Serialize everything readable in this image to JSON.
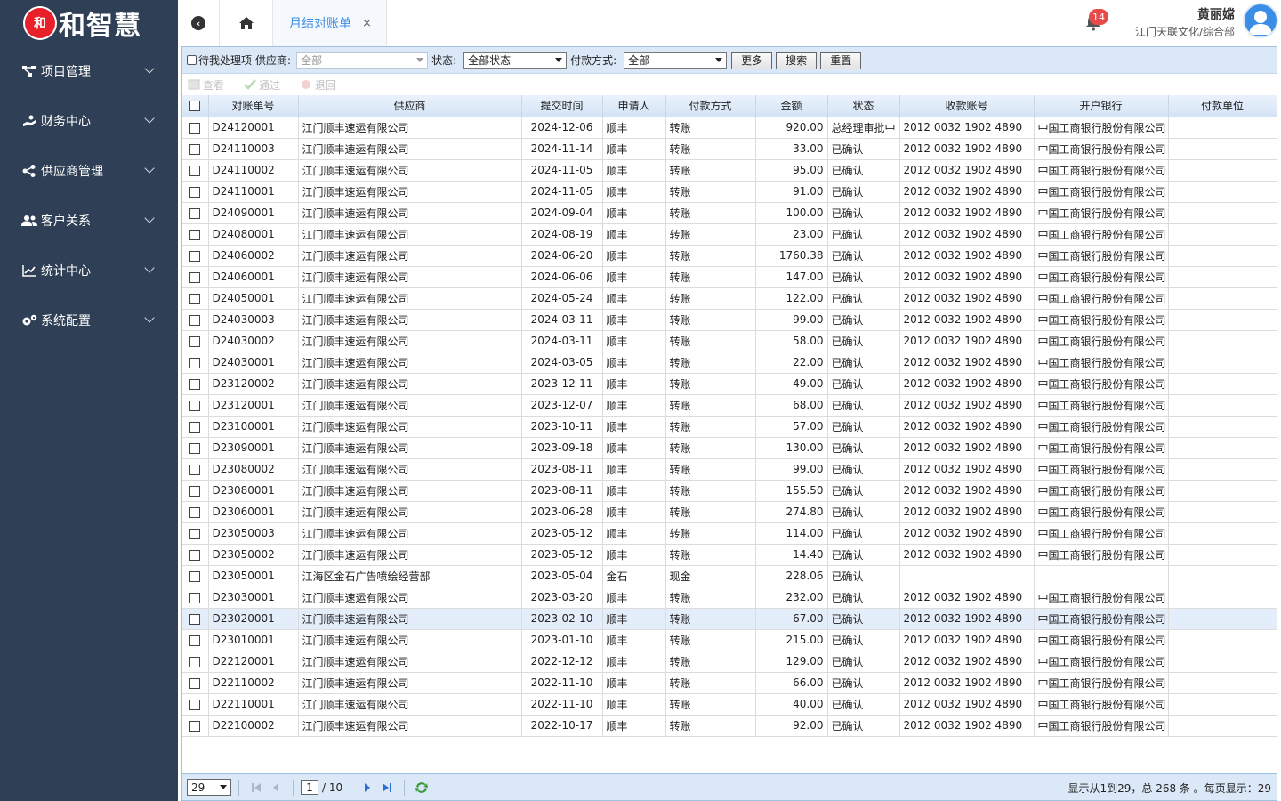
{
  "sidebar": {
    "logo_badge": "和",
    "logo_text": "和智慧",
    "items": [
      {
        "label": "项目管理",
        "icon": "project-tree-icon"
      },
      {
        "label": "财务中心",
        "icon": "finance-icon"
      },
      {
        "label": "供应商管理",
        "icon": "share-icon"
      },
      {
        "label": "客户关系",
        "icon": "users-icon"
      },
      {
        "label": "统计中心",
        "icon": "chart-icon"
      },
      {
        "label": "系统配置",
        "icon": "gears-icon"
      }
    ]
  },
  "topbar": {
    "tab_label": "月结对账单",
    "tab_close": "×",
    "notification_count": "14",
    "user_name": "黄丽嫦",
    "user_org": "江门天联文化/综合部"
  },
  "filters": {
    "pending_label": "待我处理项",
    "supplier_label": "供应商:",
    "supplier_value": "全部",
    "status_label": "状态:",
    "status_value": "全部状态",
    "pay_label": "付款方式:",
    "pay_value": "全部",
    "more": "更多",
    "search": "搜索",
    "reset": "重置"
  },
  "toolbar": {
    "view": "查看",
    "approve": "通过",
    "return": "退回"
  },
  "columns": [
    "对账单号",
    "供应商",
    "提交时间",
    "申请人",
    "付款方式",
    "金额",
    "状态",
    "收款账号",
    "开户银行",
    "付款单位"
  ],
  "rows": [
    [
      "D24120001",
      "江门顺丰速运有限公司",
      "2024-12-06",
      "顺丰",
      "转账",
      "920.00",
      "总经理审批中",
      "2012 0032 1902 4890",
      "中国工商银行股份有限公司",
      ""
    ],
    [
      "D24110003",
      "江门顺丰速运有限公司",
      "2024-11-14",
      "顺丰",
      "转账",
      "33.00",
      "已确认",
      "2012 0032 1902 4890",
      "中国工商银行股份有限公司",
      ""
    ],
    [
      "D24110002",
      "江门顺丰速运有限公司",
      "2024-11-05",
      "顺丰",
      "转账",
      "95.00",
      "已确认",
      "2012 0032 1902 4890",
      "中国工商银行股份有限公司",
      ""
    ],
    [
      "D24110001",
      "江门顺丰速运有限公司",
      "2024-11-05",
      "顺丰",
      "转账",
      "91.00",
      "已确认",
      "2012 0032 1902 4890",
      "中国工商银行股份有限公司",
      ""
    ],
    [
      "D24090001",
      "江门顺丰速运有限公司",
      "2024-09-04",
      "顺丰",
      "转账",
      "100.00",
      "已确认",
      "2012 0032 1902 4890",
      "中国工商银行股份有限公司",
      ""
    ],
    [
      "D24080001",
      "江门顺丰速运有限公司",
      "2024-08-19",
      "顺丰",
      "转账",
      "23.00",
      "已确认",
      "2012 0032 1902 4890",
      "中国工商银行股份有限公司",
      ""
    ],
    [
      "D24060002",
      "江门顺丰速运有限公司",
      "2024-06-20",
      "顺丰",
      "转账",
      "1760.38",
      "已确认",
      "2012 0032 1902 4890",
      "中国工商银行股份有限公司",
      ""
    ],
    [
      "D24060001",
      "江门顺丰速运有限公司",
      "2024-06-06",
      "顺丰",
      "转账",
      "147.00",
      "已确认",
      "2012 0032 1902 4890",
      "中国工商银行股份有限公司",
      ""
    ],
    [
      "D24050001",
      "江门顺丰速运有限公司",
      "2024-05-24",
      "顺丰",
      "转账",
      "122.00",
      "已确认",
      "2012 0032 1902 4890",
      "中国工商银行股份有限公司",
      ""
    ],
    [
      "D24030003",
      "江门顺丰速运有限公司",
      "2024-03-11",
      "顺丰",
      "转账",
      "99.00",
      "已确认",
      "2012 0032 1902 4890",
      "中国工商银行股份有限公司",
      ""
    ],
    [
      "D24030002",
      "江门顺丰速运有限公司",
      "2024-03-11",
      "顺丰",
      "转账",
      "58.00",
      "已确认",
      "2012 0032 1902 4890",
      "中国工商银行股份有限公司",
      ""
    ],
    [
      "D24030001",
      "江门顺丰速运有限公司",
      "2024-03-05",
      "顺丰",
      "转账",
      "22.00",
      "已确认",
      "2012 0032 1902 4890",
      "中国工商银行股份有限公司",
      ""
    ],
    [
      "D23120002",
      "江门顺丰速运有限公司",
      "2023-12-11",
      "顺丰",
      "转账",
      "49.00",
      "已确认",
      "2012 0032 1902 4890",
      "中国工商银行股份有限公司",
      ""
    ],
    [
      "D23120001",
      "江门顺丰速运有限公司",
      "2023-12-07",
      "顺丰",
      "转账",
      "68.00",
      "已确认",
      "2012 0032 1902 4890",
      "中国工商银行股份有限公司",
      ""
    ],
    [
      "D23100001",
      "江门顺丰速运有限公司",
      "2023-10-11",
      "顺丰",
      "转账",
      "57.00",
      "已确认",
      "2012 0032 1902 4890",
      "中国工商银行股份有限公司",
      ""
    ],
    [
      "D23090001",
      "江门顺丰速运有限公司",
      "2023-09-18",
      "顺丰",
      "转账",
      "130.00",
      "已确认",
      "2012 0032 1902 4890",
      "中国工商银行股份有限公司",
      ""
    ],
    [
      "D23080002",
      "江门顺丰速运有限公司",
      "2023-08-11",
      "顺丰",
      "转账",
      "99.00",
      "已确认",
      "2012 0032 1902 4890",
      "中国工商银行股份有限公司",
      ""
    ],
    [
      "D23080001",
      "江门顺丰速运有限公司",
      "2023-08-11",
      "顺丰",
      "转账",
      "155.50",
      "已确认",
      "2012 0032 1902 4890",
      "中国工商银行股份有限公司",
      ""
    ],
    [
      "D23060001",
      "江门顺丰速运有限公司",
      "2023-06-28",
      "顺丰",
      "转账",
      "274.80",
      "已确认",
      "2012 0032 1902 4890",
      "中国工商银行股份有限公司",
      ""
    ],
    [
      "D23050003",
      "江门顺丰速运有限公司",
      "2023-05-12",
      "顺丰",
      "转账",
      "114.00",
      "已确认",
      "2012 0032 1902 4890",
      "中国工商银行股份有限公司",
      ""
    ],
    [
      "D23050002",
      "江门顺丰速运有限公司",
      "2023-05-12",
      "顺丰",
      "转账",
      "14.40",
      "已确认",
      "2012 0032 1902 4890",
      "中国工商银行股份有限公司",
      ""
    ],
    [
      "D23050001",
      "江海区金石广告喷绘经营部",
      "2023-05-04",
      "金石",
      "现金",
      "228.06",
      "已确认",
      "",
      "",
      ""
    ],
    [
      "D23030001",
      "江门顺丰速运有限公司",
      "2023-03-20",
      "顺丰",
      "转账",
      "232.00",
      "已确认",
      "2012 0032 1902 4890",
      "中国工商银行股份有限公司",
      ""
    ],
    [
      "D23020001",
      "江门顺丰速运有限公司",
      "2023-02-10",
      "顺丰",
      "转账",
      "67.00",
      "已确认",
      "2012 0032 1902 4890",
      "中国工商银行股份有限公司",
      ""
    ],
    [
      "D23010001",
      "江门顺丰速运有限公司",
      "2023-01-10",
      "顺丰",
      "转账",
      "215.00",
      "已确认",
      "2012 0032 1902 4890",
      "中国工商银行股份有限公司",
      ""
    ],
    [
      "D22120001",
      "江门顺丰速运有限公司",
      "2022-12-12",
      "顺丰",
      "转账",
      "129.00",
      "已确认",
      "2012 0032 1902 4890",
      "中国工商银行股份有限公司",
      ""
    ],
    [
      "D22110002",
      "江门顺丰速运有限公司",
      "2022-11-10",
      "顺丰",
      "转账",
      "66.00",
      "已确认",
      "2012 0032 1902 4890",
      "中国工商银行股份有限公司",
      ""
    ],
    [
      "D22110001",
      "江门顺丰速运有限公司",
      "2022-11-10",
      "顺丰",
      "转账",
      "40.00",
      "已确认",
      "2012 0032 1902 4890",
      "中国工商银行股份有限公司",
      ""
    ],
    [
      "D22100002",
      "江门顺丰速运有限公司",
      "2022-10-17",
      "顺丰",
      "转账",
      "92.00",
      "已确认",
      "2012 0032 1902 4890",
      "中国工商银行股份有限公司",
      ""
    ]
  ],
  "highlight_row": 23,
  "pager": {
    "page_size": "29",
    "current_page": "1",
    "total_pages": "/ 10",
    "info": "显示从1到29，总 268 条 。每页显示：29"
  }
}
